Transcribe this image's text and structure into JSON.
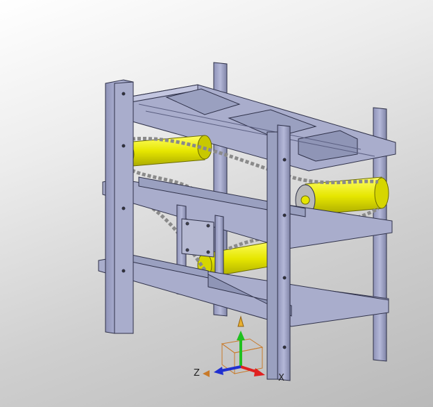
{
  "viewport": {
    "background_top": "#ffffff",
    "background_bottom": "#b9b9b9"
  },
  "colors": {
    "frame": "#a3a7c8",
    "frame_dark": "#6f7396",
    "frame_edge": "#2e3048",
    "roller": "#e6e600",
    "roller_shade": "#a8a800",
    "chain": "#c9c9c9",
    "axis_x": "#e02020",
    "axis_y": "#20c020",
    "axis_z": "#2030d0",
    "triad_box": "#c87a2a"
  },
  "triad": {
    "x_label": "X",
    "z_label": "Z",
    "x_icon": "x-axis-arrow-icon",
    "y_icon": "y-axis-arrow-icon",
    "z_icon": "z-axis-arrow-icon"
  }
}
